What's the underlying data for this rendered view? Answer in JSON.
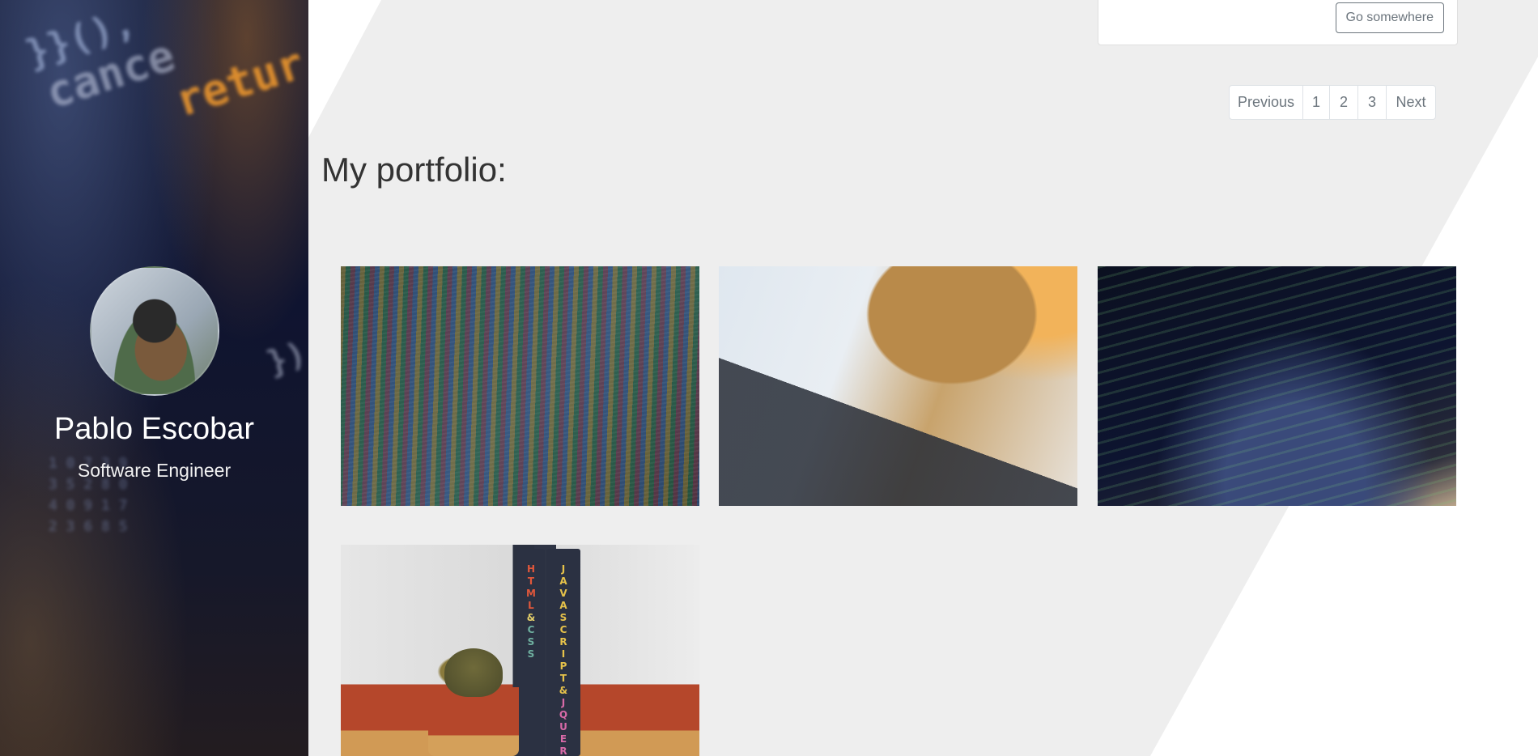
{
  "profile": {
    "name": "Pablo Escobar",
    "role": "Software Engineer"
  },
  "card": {
    "button_label": "Go somewhere"
  },
  "pagination": {
    "previous": "Previous",
    "pages": [
      "1",
      "2",
      "3"
    ],
    "next": "Next"
  },
  "portfolio": {
    "title": "My portfolio:",
    "items": [
      {
        "alt": "code-on-screen-image"
      },
      {
        "alt": "laptop-and-coffee-image"
      },
      {
        "alt": "laptop-code-dark-image"
      },
      {
        "alt": "books-and-cactus-image"
      }
    ]
  },
  "colors": {
    "background_light": "#eeeeee",
    "background_white": "#ffffff",
    "sidebar_dark": "#141a34",
    "muted_text": "#6c757d",
    "border": "#dee2e6"
  }
}
